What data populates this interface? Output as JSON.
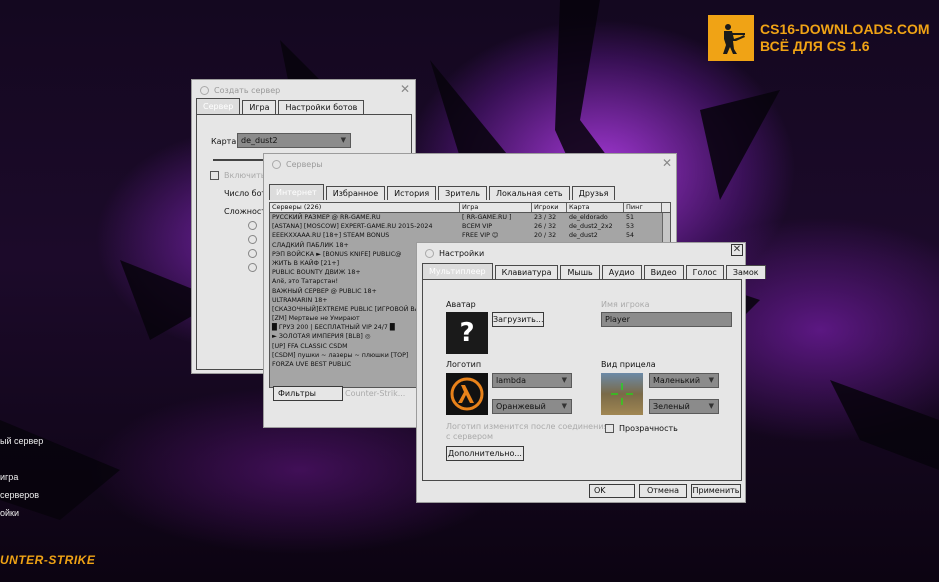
{
  "promo": {
    "line1": "CS16-DOWNLOADS.COM",
    "line2": "ВСЁ ДЛЯ CS 1.6",
    "badge_icon": "soldier-icon"
  },
  "menu": {
    "items": [
      "ый сервер",
      "игра",
      "серверов",
      "ойки"
    ],
    "logo": "UNTER-STRIKE"
  },
  "create_server": {
    "title": "Создать сервер",
    "tabs": [
      "Сервер",
      "Игра",
      "Настройки ботов"
    ],
    "map_label": "Карта",
    "map_value": "de_dust2",
    "bots_enable_label": "Включить",
    "bot_count_label": "Число бот",
    "difficulty_label": "Сложность"
  },
  "servers": {
    "title": "Серверы",
    "tabs": [
      "Интернет",
      "Избранное",
      "История",
      "Зритель",
      "Локальная сеть",
      "Друзья"
    ],
    "columns": [
      "Серверы (226)",
      "Игра",
      "Игроки",
      "Карта",
      "Пинг"
    ],
    "rows": [
      [
        "РУССКИЙ РАЗМЕР @ RR-GAME.RU",
        "[ RR-GAME.RU ]",
        "23 / 32",
        "de_eldorado",
        "51"
      ],
      [
        "[ASTANA] [MOSCOW] EXPERT-GAME.RU 2015-2024",
        "ВСЕМ VIP",
        "26 / 32",
        "de_dust2_2x2",
        "53"
      ],
      [
        "ЕЕЕКХХААА.RU [18+] STEAM BONUS",
        "FREE VIP ☺",
        "20 / 32",
        "de_dust2",
        "54"
      ],
      [
        "СЛАДКИЙ ПАБЛИК 18+",
        "",
        "",
        "",
        ""
      ],
      [
        "РЭП ВОЙСКА ► [BONUS KNIFE] PUBLIC@",
        "",
        "",
        "",
        ""
      ],
      [
        "ЖИТЬ В КАЙФ [21+]",
        "",
        "",
        "",
        ""
      ],
      [
        "PUBLIC BOUNTY ДВИЖ 18+",
        "",
        "",
        "",
        ""
      ],
      [
        "Алё, это Татарстан!",
        "",
        "",
        "",
        ""
      ],
      [
        "ВАЖНЫЙ СЕРВЕР @ PUBLIC 18+",
        "",
        "",
        "",
        ""
      ],
      [
        "ULTRAMARIN 18+",
        "",
        "",
        "",
        ""
      ],
      [
        "[СКАЗОЧНЫЙ]EXTREME PUBLIC [ИГРОВОЙ ВА",
        "",
        "",
        "",
        ""
      ],
      [
        "[ZM] Мертвые не Умирают",
        "",
        "",
        "",
        ""
      ],
      [
        "█ ГРУЗ 200 | БЕСПЛАТНЫЙ VIP 24/7 █",
        "",
        "",
        "",
        ""
      ],
      [
        "► ЗОЛОТАЯ ИМПЕРИЯ [BLB] ◎",
        "",
        "",
        "",
        ""
      ],
      [
        "[UP] FFA CLASSIC CSDM",
        "",
        "",
        "",
        ""
      ],
      [
        "[CSDM] пушки ~ лазеры ~ плюшки [TOP]",
        "",
        "",
        "",
        ""
      ],
      [
        "FORZA UVE BEST PUBLIC",
        "",
        "",
        "",
        ""
      ]
    ],
    "filters_button": "Фильтры",
    "filter_game": "Counter-Strik..."
  },
  "settings": {
    "title": "Настройки",
    "tabs": [
      "Мультиплеер",
      "Клавиатура",
      "Мышь",
      "Аудио",
      "Видео",
      "Голос",
      "Замок"
    ],
    "avatar_label": "Аватар",
    "upload_button": "Загрузить...",
    "name_label": "Имя игрока",
    "name_value": "Player",
    "logo_label": "Логотип",
    "logo_value": "lambda",
    "logo_color": "Оранжевый",
    "logo_note_1": "Логотип изменится после соединения",
    "logo_note_2": "с сервером",
    "advanced_button": "Дополнительно...",
    "crosshair_label": "Вид прицела",
    "crosshair_size": "Маленький",
    "crosshair_color": "Зеленый",
    "transparency_label": "Прозрачность",
    "ok_button": "OK",
    "cancel_button": "Отмена",
    "apply_button": "Применить"
  },
  "colors": {
    "accent": "#f0a315",
    "window_bg": "#e6e6e6",
    "combo_bg": "#8b8b8b"
  }
}
